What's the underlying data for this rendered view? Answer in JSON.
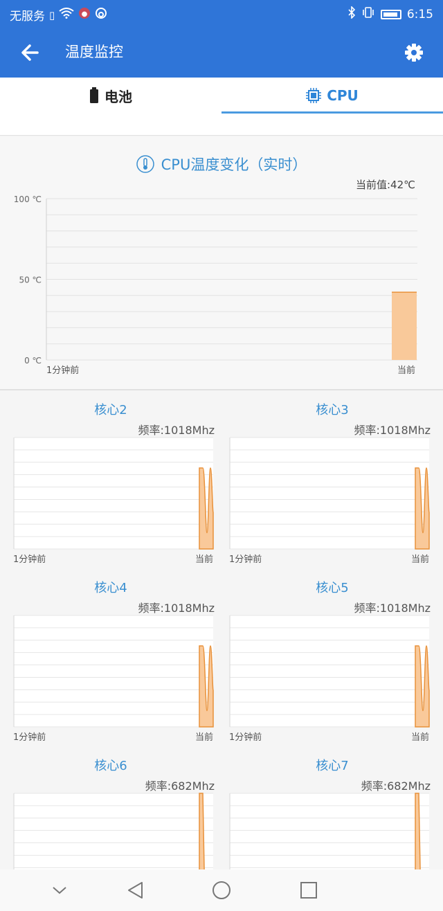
{
  "status_bar": {
    "carrier": "无服务",
    "time": "6:15",
    "icons": [
      "sim-alert-icon",
      "wifi-icon",
      "notification-icon",
      "app-icon",
      "bluetooth-icon",
      "vibrate-icon",
      "battery-icon"
    ]
  },
  "app_bar": {
    "title": "温度监控",
    "back_icon": "arrow-left-icon",
    "settings_icon": "gear-icon"
  },
  "tabs": [
    {
      "label": "电池",
      "icon": "battery-icon",
      "active": false
    },
    {
      "label": "CPU",
      "icon": "cpu-chip-icon",
      "active": true
    }
  ],
  "colors": {
    "primary": "#2f75d8",
    "accent": "#3a8fd0",
    "chart_fill": "#f9c99a",
    "chart_line": "#e8913a"
  },
  "main_chart": {
    "title": "CPU温度变化（实时）",
    "current_label": "当前值:42℃"
  },
  "cores": [
    {
      "title": "核心2",
      "freq": "频率:1018Mhz"
    },
    {
      "title": "核心3",
      "freq": "频率:1018Mhz"
    },
    {
      "title": "核心4",
      "freq": "频率:1018Mhz"
    },
    {
      "title": "核心5",
      "freq": "频率:1018Mhz"
    },
    {
      "title": "核心6",
      "freq": "频率:682Mhz"
    },
    {
      "title": "核心7",
      "freq": "频率:682Mhz"
    }
  ],
  "chart_data": [
    {
      "type": "area",
      "title": "CPU温度变化（实时）",
      "y_tick_labels": [
        "100 ℃",
        "50 ℃",
        "0 ℃"
      ],
      "ylim": [
        0,
        100
      ],
      "x_tick_labels": [
        "1分钟前",
        "当前"
      ],
      "series": [
        {
          "values": [
            42,
            42
          ]
        }
      ],
      "grid": true
    },
    {
      "type": "area",
      "title": "核心2",
      "x_tick_labels": [
        "1分钟前",
        "当前"
      ],
      "series": [
        {
          "values": [
            1,
            1,
            0.2,
            1,
            0.45
          ]
        }
      ],
      "grid": true
    },
    {
      "type": "area",
      "title": "核心3",
      "x_tick_labels": [
        "1分钟前",
        "当前"
      ],
      "series": [
        {
          "values": [
            1,
            1,
            0.2,
            1,
            0.45
          ]
        }
      ],
      "grid": true
    },
    {
      "type": "area",
      "title": "核心4",
      "x_tick_labels": [
        "1分钟前",
        "当前"
      ],
      "series": [
        {
          "values": [
            1,
            1,
            0.2,
            1,
            0.45
          ]
        }
      ],
      "grid": true
    },
    {
      "type": "area",
      "title": "核心5",
      "x_tick_labels": [
        "1分钟前",
        "当前"
      ],
      "series": [
        {
          "values": [
            1,
            1,
            0.2,
            1,
            0.45
          ]
        }
      ],
      "grid": true
    },
    {
      "type": "area",
      "title": "核心6",
      "x_tick_labels": [],
      "series": [
        {
          "values": [
            1,
            0.9,
            0.1
          ]
        }
      ],
      "grid": true
    },
    {
      "type": "area",
      "title": "核心7",
      "x_tick_labels": [],
      "series": [
        {
          "values": [
            1,
            0.9,
            0.1
          ]
        }
      ],
      "grid": true
    }
  ],
  "nav_bar": {
    "icons": [
      "chevron-down-icon",
      "back-triangle-icon",
      "home-circle-icon",
      "recents-square-icon"
    ]
  }
}
